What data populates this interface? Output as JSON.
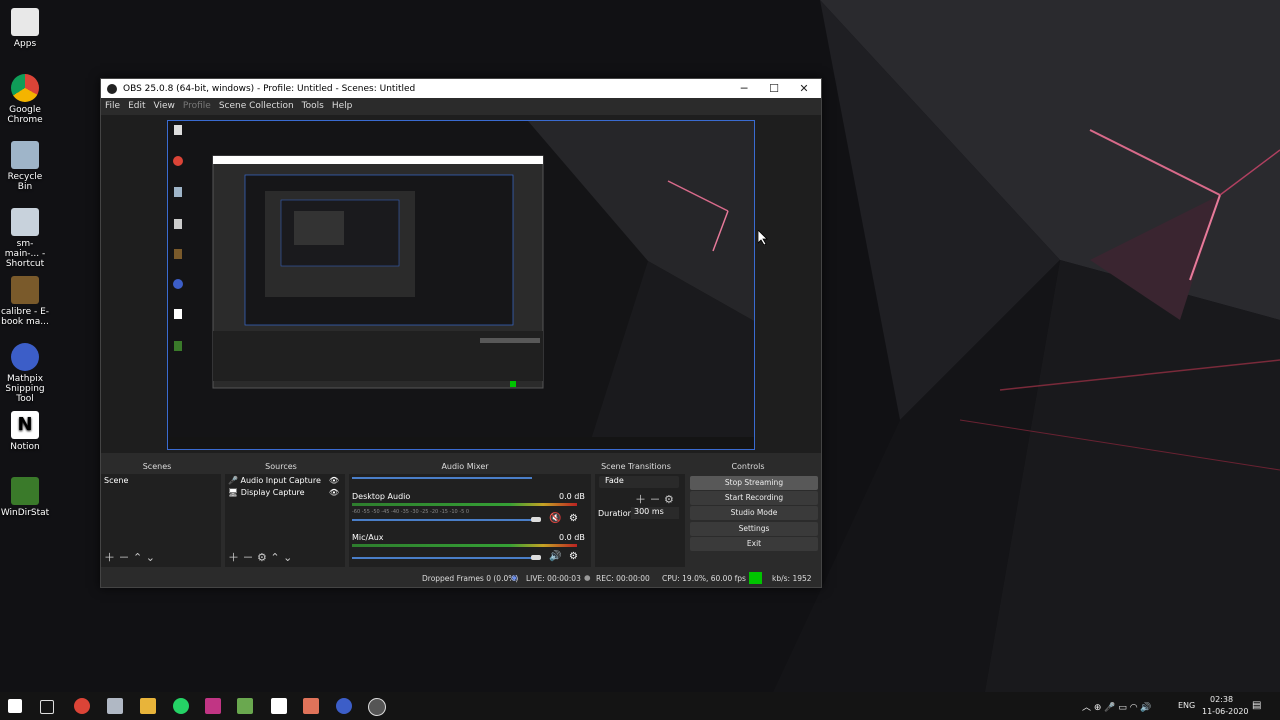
{
  "desktop": {
    "icons": [
      {
        "label": "Apps",
        "color": "#e8e8e8"
      },
      {
        "label": "Google Chrome",
        "color": "#db4437"
      },
      {
        "label": "Recycle Bin",
        "color": "#9fb5c9"
      },
      {
        "label": "sm-main-... - Shortcut",
        "color": "#c8d2dc"
      },
      {
        "label": "calibre - E-book ma...",
        "color": "#7a5a2b"
      },
      {
        "label": "Mathpix Snipping Tool",
        "color": "#3c5ec8"
      },
      {
        "label": "Notion",
        "color": "#ffffff"
      },
      {
        "label": "WinDirStat",
        "color": "#3a7a2a"
      }
    ]
  },
  "obs": {
    "title": "OBS 25.0.8 (64-bit, windows) - Profile: Untitled - Scenes: Untitled",
    "window_controls": {
      "minimize": "─",
      "maximize": "☐",
      "close": "✕"
    },
    "menu": [
      "File",
      "Edit",
      "View",
      "Profile",
      "Scene Collection",
      "Tools",
      "Help"
    ],
    "docks": {
      "scenes": "Scenes",
      "sources": "Sources",
      "audio_mixer": "Audio Mixer",
      "scene_transitions": "Scene Transitions",
      "controls": "Controls"
    },
    "scenes_list": [
      "Scene"
    ],
    "sources_list": [
      {
        "label": "Audio Input Capture",
        "icon": "microphone-icon"
      },
      {
        "label": "Display Capture",
        "icon": "monitor-icon"
      }
    ],
    "mixer": [
      {
        "name": "Desktop Audio",
        "db": "0.0 dB",
        "level": 0.9,
        "muted": true
      },
      {
        "name": "Mic/Aux",
        "db": "0.0 dB",
        "level": 0.9,
        "muted": false
      }
    ],
    "meter_ticks": "-60 -55 -50 -45 -40 -35 -30 -25 -20 -15 -10 -5 0",
    "transitions": {
      "selected": "Fade",
      "duration_label": "Duration",
      "duration_value": "300 ms"
    },
    "controls": [
      "Stop Streaming",
      "Start Recording",
      "Studio Mode",
      "Settings",
      "Exit"
    ],
    "status": {
      "dropped": "Dropped Frames 0 (0.0%)",
      "live": "LIVE: 00:00:03",
      "rec": "REC: 00:00:00",
      "cpu": "CPU: 19.0%, 60.00 fps",
      "kbps": "kb/s: 1952",
      "health_color": "#00c400"
    }
  },
  "taskbar": {
    "language": "ENG",
    "time": "02:38",
    "date": "11-06-2020"
  }
}
